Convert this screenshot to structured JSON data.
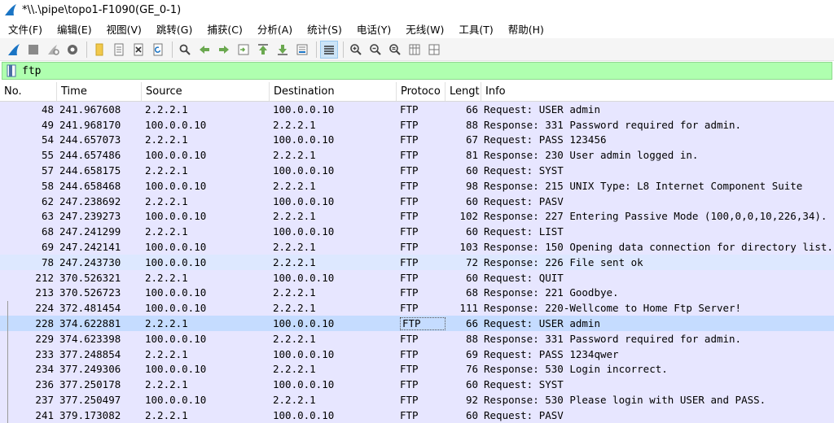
{
  "window": {
    "title": "*\\\\.\\pipe\\topo1-F1090(GE_0-1)"
  },
  "menu": [
    "文件(F)",
    "编辑(E)",
    "视图(V)",
    "跳转(G)",
    "捕获(C)",
    "分析(A)",
    "统计(S)",
    "电话(Y)",
    "无线(W)",
    "工具(T)",
    "帮助(H)"
  ],
  "filter": {
    "value": "ftp"
  },
  "columns": {
    "no": "No.",
    "time": "Time",
    "source": "Source",
    "destination": "Destination",
    "protocol": "Protoco",
    "length": "Lengt",
    "info": "Info"
  },
  "rows": [
    {
      "no": "48",
      "time": "241.967608",
      "source": "2.2.2.1",
      "destination": "100.0.0.10",
      "protocol": "FTP",
      "length": "66",
      "info": "Request: USER admin"
    },
    {
      "no": "49",
      "time": "241.968170",
      "source": "100.0.0.10",
      "destination": "2.2.2.1",
      "protocol": "FTP",
      "length": "88",
      "info": "Response: 331 Password required for admin."
    },
    {
      "no": "54",
      "time": "244.657073",
      "source": "2.2.2.1",
      "destination": "100.0.0.10",
      "protocol": "FTP",
      "length": "67",
      "info": "Request: PASS 123456"
    },
    {
      "no": "55",
      "time": "244.657486",
      "source": "100.0.0.10",
      "destination": "2.2.2.1",
      "protocol": "FTP",
      "length": "81",
      "info": "Response: 230 User admin logged in."
    },
    {
      "no": "57",
      "time": "244.658175",
      "source": "2.2.2.1",
      "destination": "100.0.0.10",
      "protocol": "FTP",
      "length": "60",
      "info": "Request: SYST"
    },
    {
      "no": "58",
      "time": "244.658468",
      "source": "100.0.0.10",
      "destination": "2.2.2.1",
      "protocol": "FTP",
      "length": "98",
      "info": "Response: 215 UNIX Type: L8 Internet Component Suite"
    },
    {
      "no": "62",
      "time": "247.238692",
      "source": "2.2.2.1",
      "destination": "100.0.0.10",
      "protocol": "FTP",
      "length": "60",
      "info": "Request: PASV"
    },
    {
      "no": "63",
      "time": "247.239273",
      "source": "100.0.0.10",
      "destination": "2.2.2.1",
      "protocol": "FTP",
      "length": "102",
      "info": "Response: 227 Entering Passive Mode (100,0,0,10,226,34)."
    },
    {
      "no": "68",
      "time": "247.241299",
      "source": "2.2.2.1",
      "destination": "100.0.0.10",
      "protocol": "FTP",
      "length": "60",
      "info": "Request: LIST"
    },
    {
      "no": "69",
      "time": "247.242141",
      "source": "100.0.0.10",
      "destination": "2.2.2.1",
      "protocol": "FTP",
      "length": "103",
      "info": "Response: 150 Opening data connection for directory list."
    },
    {
      "no": "78",
      "time": "247.243730",
      "source": "100.0.0.10",
      "destination": "2.2.2.1",
      "protocol": "FTP",
      "length": "72",
      "info": "Response: 226 File sent ok"
    },
    {
      "no": "212",
      "time": "370.526321",
      "source": "2.2.2.1",
      "destination": "100.0.0.10",
      "protocol": "FTP",
      "length": "60",
      "info": "Request: QUIT"
    },
    {
      "no": "213",
      "time": "370.526723",
      "source": "100.0.0.10",
      "destination": "2.2.2.1",
      "protocol": "FTP",
      "length": "68",
      "info": "Response: 221 Goodbye."
    },
    {
      "no": "224",
      "time": "372.481454",
      "source": "100.0.0.10",
      "destination": "2.2.2.1",
      "protocol": "FTP",
      "length": "111",
      "info": "Response: 220-Wellcome to Home Ftp Server!"
    },
    {
      "no": "228",
      "time": "374.622881",
      "source": "2.2.2.1",
      "destination": "100.0.0.10",
      "protocol": "FTP",
      "length": "66",
      "info": "Request: USER admin"
    },
    {
      "no": "229",
      "time": "374.623398",
      "source": "100.0.0.10",
      "destination": "2.2.2.1",
      "protocol": "FTP",
      "length": "88",
      "info": "Response: 331 Password required for admin."
    },
    {
      "no": "233",
      "time": "377.248854",
      "source": "2.2.2.1",
      "destination": "100.0.0.10",
      "protocol": "FTP",
      "length": "69",
      "info": "Request: PASS 1234qwer"
    },
    {
      "no": "234",
      "time": "377.249306",
      "source": "100.0.0.10",
      "destination": "2.2.2.1",
      "protocol": "FTP",
      "length": "76",
      "info": "Response: 530 Login incorrect."
    },
    {
      "no": "236",
      "time": "377.250178",
      "source": "2.2.2.1",
      "destination": "100.0.0.10",
      "protocol": "FTP",
      "length": "60",
      "info": "Request: SYST"
    },
    {
      "no": "237",
      "time": "377.250497",
      "source": "100.0.0.10",
      "destination": "2.2.2.1",
      "protocol": "FTP",
      "length": "92",
      "info": "Response: 530 Please login with USER and PASS."
    },
    {
      "no": "241",
      "time": "379.173082",
      "source": "2.2.2.1",
      "destination": "100.0.0.10",
      "protocol": "FTP",
      "length": "60",
      "info": "Request: PASV"
    }
  ],
  "selected_row_index": 14,
  "highlight_row_index": 10,
  "colors": {
    "row_ftp": "#e7e6ff",
    "row_selected": "#c5dcff",
    "filter_valid": "#afffaf",
    "brand": "#1a74c4"
  }
}
